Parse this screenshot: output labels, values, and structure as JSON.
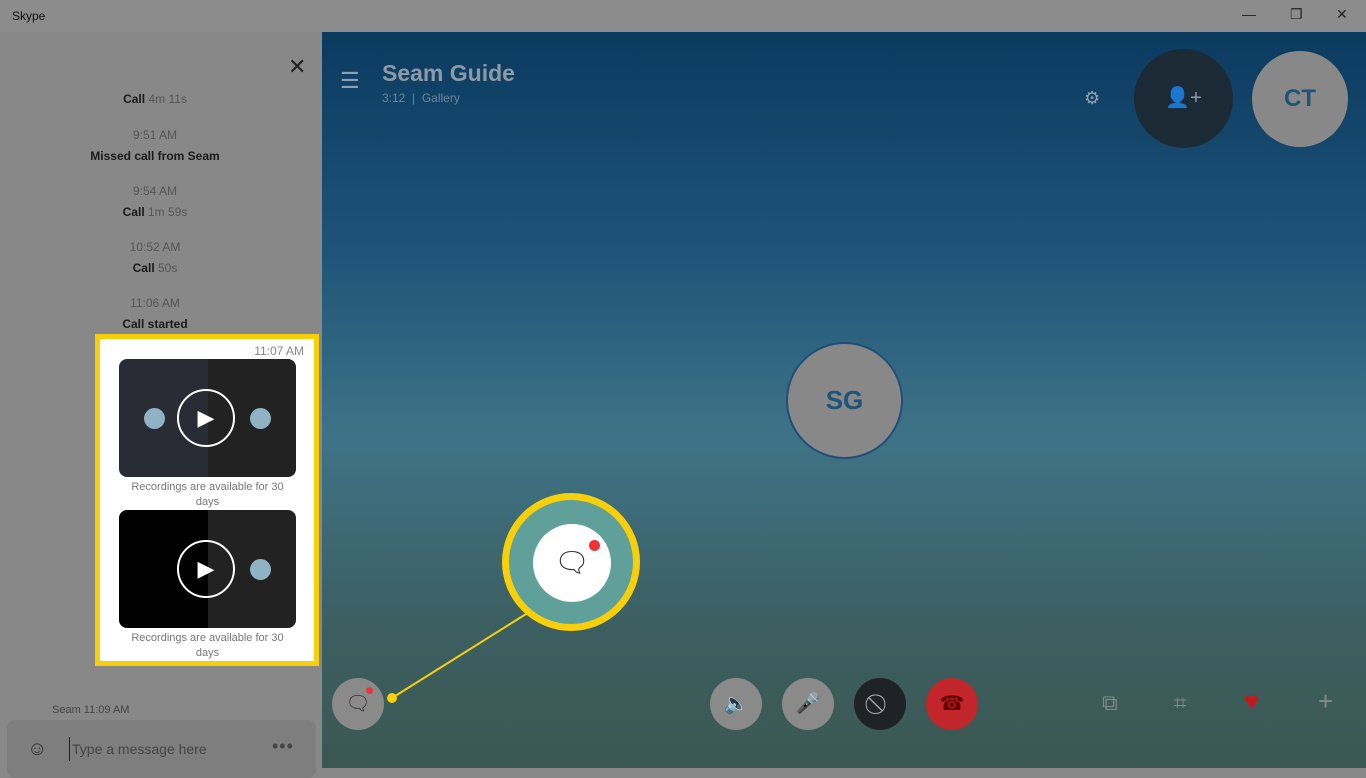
{
  "window": {
    "title": "Skype",
    "minimize": "—",
    "restore": "❐",
    "close": "✕"
  },
  "chat": {
    "events": [
      {
        "time": "",
        "label": "Call",
        "detail": "4m 11s"
      },
      {
        "time": "9:51 AM",
        "label": "Missed call from Seam",
        "detail": ""
      },
      {
        "time": "9:54 AM",
        "label": "Call",
        "detail": "1m 59s"
      },
      {
        "time": "10:52 AM",
        "label": "Call",
        "detail": "50s"
      },
      {
        "time": "11:06 AM",
        "label": "Call started",
        "detail": ""
      }
    ],
    "recordings_time": "11:07 AM",
    "recording_caption": "Recordings are available for 30 days",
    "next_message": "Seam  11:09 AM",
    "composer_placeholder": "Type a message here"
  },
  "call": {
    "title": "Seam Guide",
    "duration": "3:12",
    "separator": "|",
    "view": "Gallery",
    "participant_initials": "SG",
    "self_initials": "CT"
  },
  "icons": {
    "menu": "☰",
    "gear": "⚙",
    "add_person": "👤+",
    "play": "▶",
    "chat": "🗨",
    "emoji": "☺",
    "more": "•••",
    "close": "✕"
  },
  "colors": {
    "highlight": "#f7cf0a",
    "end_call": "#c2262a",
    "heart": "#c21a1a"
  }
}
